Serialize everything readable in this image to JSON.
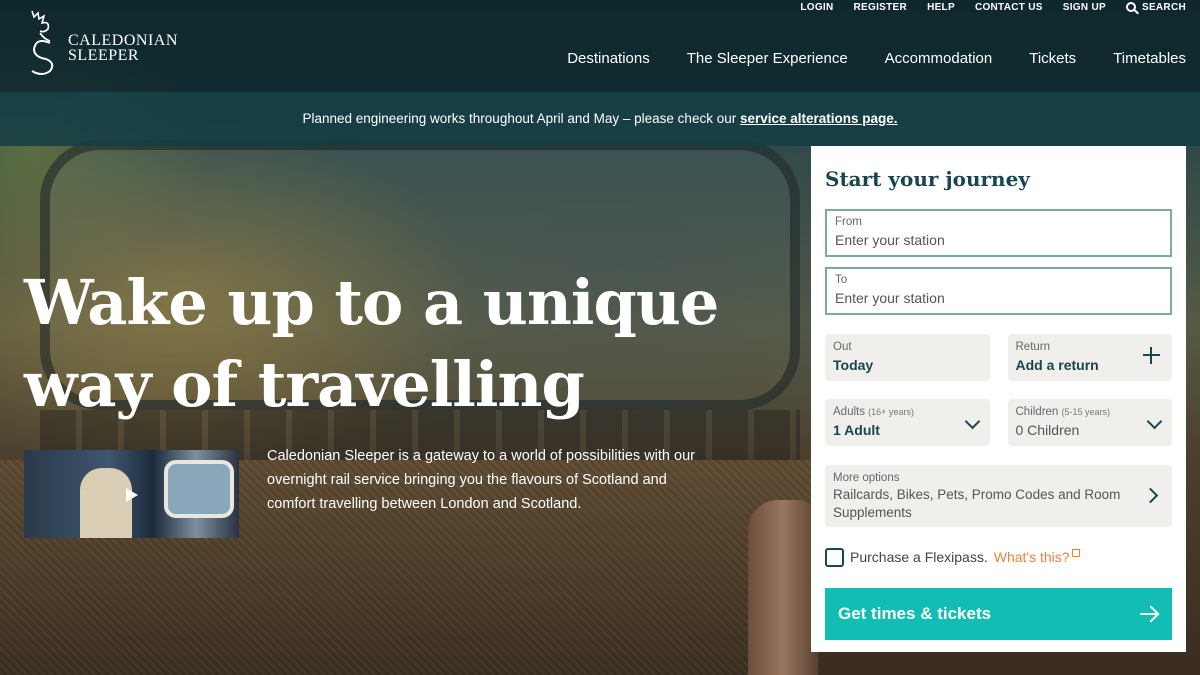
{
  "utility_nav": {
    "login": "LOGIN",
    "register": "REGISTER",
    "help": "HELP",
    "contact": "CONTACT US",
    "signup": "SIGN UP",
    "search": "SEARCH"
  },
  "brand": {
    "line1": "CALEDONIAN",
    "line2": "SLEEPER"
  },
  "main_nav": [
    {
      "label": "Destinations"
    },
    {
      "label": "The Sleeper Experience"
    },
    {
      "label": "Accommodation"
    },
    {
      "label": "Tickets"
    },
    {
      "label": "Timetables"
    }
  ],
  "notice": {
    "text": "Planned engineering works throughout April and May – please check our ",
    "link": "service alterations page."
  },
  "hero": {
    "headline_line1": "Wake up to a unique",
    "headline_line2": "way of travelling",
    "intro": "Caledonian Sleeper is a gateway to a world of possibilities with our overnight rail service bringing you the flavours of Scotland and comfort travelling between London and Scotland."
  },
  "booking": {
    "title": "Start your journey",
    "from_label": "From",
    "from_placeholder": "Enter your station",
    "to_label": "To",
    "to_placeholder": "Enter your station",
    "out_label": "Out",
    "out_value": "Today",
    "return_label": "Return",
    "return_value": "Add a return",
    "adults_label": "Adults",
    "adults_hint": "(16+ years)",
    "adults_value": "1 Adult",
    "children_label": "Children",
    "children_hint": "(5-15 years)",
    "children_value": "0 Children",
    "more_label": "More options",
    "more_desc": "Railcards, Bikes, Pets, Promo Codes and Room Supplements",
    "flexipass_text": "Purchase a Flexipass.",
    "flexipass_link": "What's this?",
    "cta": "Get times & tickets"
  },
  "colors": {
    "header_bg": "#0c262c",
    "brand_teal": "#17464e",
    "cta": "#12bdb4",
    "link_orange": "#e8823a"
  }
}
